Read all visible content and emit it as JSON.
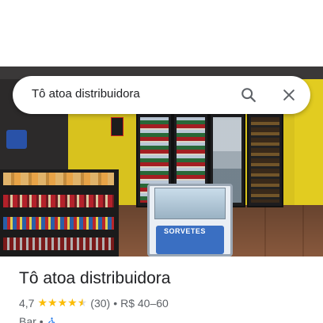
{
  "search": {
    "query": "Tô atoa distribuidora",
    "search_icon": "search-icon",
    "close_icon": "close-icon"
  },
  "hero": {
    "freezer_brand": "SORVETES"
  },
  "place": {
    "name": "Tô atoa distribuidora",
    "rating": "4,7",
    "stars": 4.7,
    "review_count": "(30)",
    "bullet": "•",
    "price_range": "R$ 40–60",
    "category": "Bar",
    "accessibility_icon": "wheelchair-accessible-icon"
  },
  "colors": {
    "star": "#fbbc04",
    "text_primary": "#202124",
    "text_secondary": "#5f6368",
    "accessibility": "#1a73e8"
  }
}
